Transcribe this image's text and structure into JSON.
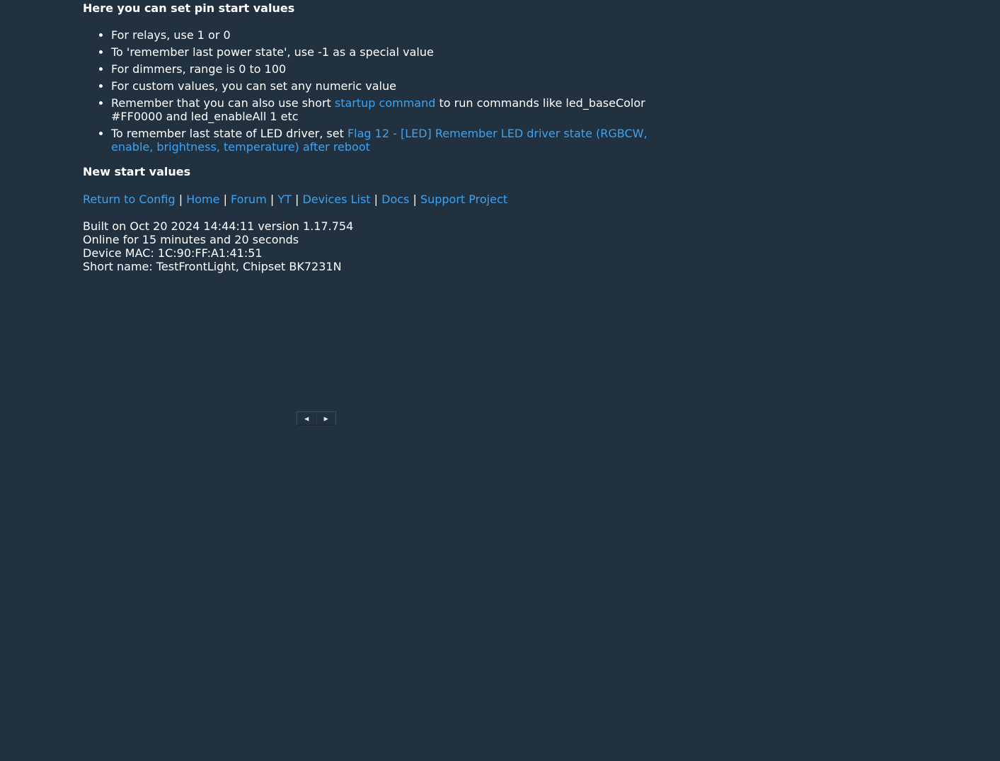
{
  "heading_top": "Here you can set pin start values",
  "tips": {
    "t1": "For relays, use 1 or 0",
    "t2": "To 'remember last power state', use -1 as a special value",
    "t3": "For dimmers, range is 0 to 100",
    "t4": "For custom values, you can set any numeric value",
    "t5_prefix": "Remember that you can also use short ",
    "t5_link": "startup command",
    "t5_suffix": " to run commands like led_baseColor #FF0000 and led_enableAll 1 etc",
    "t6_prefix": "To remember last state of LED driver, set ",
    "t6_link": "Flag 12 - [LED] Remember LED driver state (RGBCW, enable, brightness, temperature) after reboot"
  },
  "heading_new": "New start values",
  "nav": {
    "return_config": "Return to Config",
    "home": "Home",
    "forum": "Forum",
    "yt": "YT",
    "devices_list": "Devices List",
    "docs": "Docs",
    "support": "Support Project",
    "separator": " | "
  },
  "info": {
    "built": "Built on Oct 20 2024 14:44:11 version 1.17.754",
    "online": "Online for 15 minutes and 20 seconds",
    "mac": "Device MAC: 1C:90:FF:A1:41:51",
    "shortname": "Short name: TestFrontLight, Chipset BK7231N"
  },
  "arrows": {
    "left": "◀",
    "right": "▶"
  },
  "colors": {
    "background": "#21313f",
    "link": "#3fa3f0",
    "text": "#ffffff"
  }
}
